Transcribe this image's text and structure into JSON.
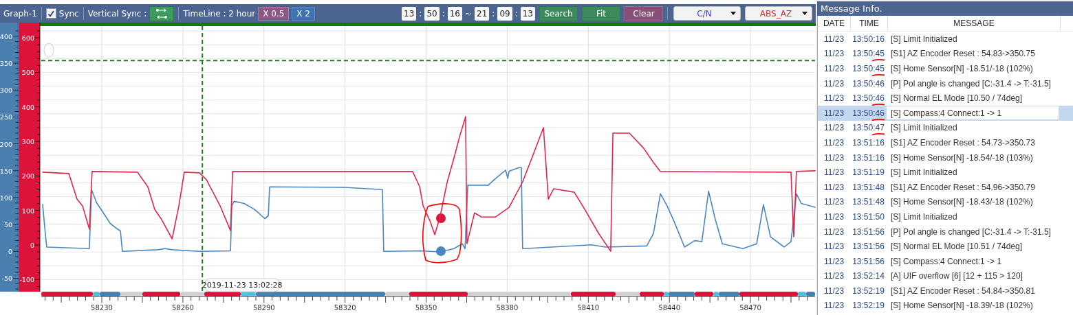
{
  "graph": {
    "title": "Graph-1",
    "sync": {
      "label": "Sync",
      "checked": true
    },
    "vertical_sync_label": "Vertical Sync :",
    "timeline_label": "TimeLine : 2 hour",
    "zoom_buttons": [
      {
        "label": "X 0.5",
        "kind": "zoom-out"
      },
      {
        "label": "X 2",
        "kind": "zoom-in"
      }
    ],
    "time_range": {
      "start": [
        "13",
        "50",
        "16"
      ],
      "end": [
        "21",
        "09",
        "13"
      ],
      "time_separator": ":",
      "range_separator": "~"
    },
    "buttons": [
      {
        "label": "Search",
        "kind": "search"
      },
      {
        "label": "Fit",
        "kind": "fit"
      },
      {
        "label": "Clear",
        "kind": "clear"
      }
    ],
    "dropdowns": [
      {
        "value": "C/N",
        "color": "#3344ee"
      },
      {
        "value": "ABS_AZ",
        "color": "#ee2233"
      }
    ],
    "cursor_tooltip": "2019-11-23 13:02:28",
    "chart_data": {
      "type": "line",
      "xlim": [
        58207.6,
        58493.9
      ],
      "ylim": [
        -75,
        419
      ],
      "y2lim": [
        -135,
        634
      ],
      "xticks": [
        58230,
        58260,
        58290,
        58320,
        58350,
        58380,
        58410,
        58440,
        58470
      ],
      "yticks": [
        -50,
        0,
        50,
        100,
        150,
        200,
        250,
        300,
        350,
        400
      ],
      "y2ticks": [
        -100,
        0,
        100,
        200,
        300,
        400,
        500,
        600
      ],
      "series": [
        {
          "color": "#4a86c0",
          "x": [
            58208.1,
            58209.1,
            58209.6,
            58225.4,
            58226.2,
            58228,
            58230.5,
            58233.1,
            58235.6,
            58236.9,
            58237.6,
            58250.9,
            58253.4,
            58256,
            58266.1,
            58277.6,
            58278.1,
            58278.9,
            58282.7,
            58286.5,
            58290.3,
            58291.6,
            58292.1,
            58319.6,
            58333.8,
            58334.3,
            58348.1,
            58355.2,
            58360.3,
            58363.4,
            58364.4,
            58365.4,
            58373,
            58375.1,
            58379.4,
            58380.2,
            58380.7,
            58384.5,
            58385.2,
            58385.7,
            58411.2,
            58416.3,
            58431.6,
            58434.1,
            58436.7,
            58439.2,
            58441.7,
            58445.6,
            58449.4,
            58452,
            58454.5,
            58457,
            58459.6,
            58467.2,
            58472.3,
            58474.8,
            58477.4,
            58482.5,
            58485,
            58487,
            58488.8,
            58493.9
          ],
          "values": [
            87,
            33,
            8,
            5,
            115,
            91,
            72,
            52,
            42,
            38,
            0,
            3,
            5,
            3,
            0,
            1,
            84,
            93,
            89,
            78,
            61,
            66,
            120,
            119,
            115,
            0,
            1,
            -1,
            5,
            14,
            5,
            123,
            123,
            133,
            151,
            136,
            149,
            156,
            156,
            5,
            12,
            8,
            10,
            33,
            107,
            84,
            56,
            8,
            20,
            18,
            112,
            59,
            14,
            5,
            14,
            87,
            27,
            8,
            18,
            107,
            89,
            82
          ]
        },
        {
          "color": "#e0284a",
          "axis": "y2",
          "x": [
            58208.1,
            58217.8,
            58220.8,
            58222.9,
            58225.4,
            58226.4,
            58243.2,
            58247,
            58249.6,
            58252.1,
            58256,
            58258.5,
            58260.5,
            58266.1,
            58268.7,
            58273.8,
            58277.6,
            58278.4,
            58345,
            58347.6,
            58348.9,
            58351.4,
            58353.2,
            58355.2,
            58357.8,
            58360.3,
            58362.3,
            58364.6,
            58365.1,
            58367.9,
            58370.5,
            58375.6,
            58380.7,
            58385.7,
            58389.6,
            58393.4,
            58395.2,
            58397.2,
            58404.8,
            58408.7,
            58413.8,
            58418.3,
            58419.1,
            58425.2,
            58430.3,
            58434.1,
            58436.7,
            58485,
            58486,
            58487,
            58493.9
          ],
          "values": [
            211,
            207,
            133,
            113,
            46,
            213,
            211,
            169,
            103,
            74,
            18,
            113,
            211,
            209,
            189,
            113,
            42,
            213,
            213,
            169,
            113,
            70,
            30,
            84,
            183,
            252,
            312,
            372,
            4,
            93,
            81,
            81,
            109,
            183,
            262,
            340,
            133,
            163,
            153,
            103,
            34,
            -18,
            324,
            324,
            282,
            239,
            213,
            211,
            24,
            213,
            215
          ]
        }
      ],
      "grid": true,
      "ref_lines": [
        {
          "axis": "y",
          "value": 355
        },
        {
          "axis": "x",
          "value": 58267.2
        }
      ]
    }
  },
  "messages": {
    "title": "Message Info.",
    "columns": [
      "DATE",
      "TIME",
      "MESSAGE"
    ],
    "rows": [
      {
        "date": "11/23",
        "time": "13:50:16",
        "message": "[S] Limit Initialized",
        "selected": false,
        "underlined": false
      },
      {
        "date": "11/23",
        "time": "13:50:45",
        "message": "[S1] AZ Encoder Reset : 54.83->350.75",
        "selected": false,
        "underlined": true
      },
      {
        "date": "11/23",
        "time": "13:50:45",
        "message": "[S] Home Sensor[N] -18.51/-18 (102%)",
        "selected": false,
        "underlined": true
      },
      {
        "date": "11/23",
        "time": "13:50:46",
        "message": "[P] Pol angle is changed [C:-31.4 -> T:-31.5]",
        "selected": false,
        "underlined": false
      },
      {
        "date": "11/23",
        "time": "13:50:46",
        "message": "[S] Normal EL Mode [10.50 / 74deg]",
        "selected": false,
        "underlined": true
      },
      {
        "date": "11/23",
        "time": "13:50:46",
        "message": "[S] Compass:4 Connect:1 -> 1",
        "selected": true,
        "underlined": true
      },
      {
        "date": "11/23",
        "time": "13:50:47",
        "message": "[S] Limit Initialized",
        "selected": false,
        "underlined": true
      },
      {
        "date": "11/23",
        "time": "13:51:16",
        "message": "[S1] AZ Encoder Reset : 54.73->350.73",
        "selected": false,
        "underlined": false
      },
      {
        "date": "11/23",
        "time": "13:51:16",
        "message": "[S] Home Sensor[N] -18.54/-18 (103%)",
        "selected": false,
        "underlined": false
      },
      {
        "date": "11/23",
        "time": "13:51:19",
        "message": "[S] Limit Initialized",
        "selected": false,
        "underlined": false
      },
      {
        "date": "11/23",
        "time": "13:51:48",
        "message": "[S1] AZ Encoder Reset : 54.96->350.79",
        "selected": false,
        "underlined": false
      },
      {
        "date": "11/23",
        "time": "13:51:48",
        "message": "[S] Home Sensor[N] -18.43/-18 (102%)",
        "selected": false,
        "underlined": false
      },
      {
        "date": "11/23",
        "time": "13:51:50",
        "message": "[S] Limit Initialized",
        "selected": false,
        "underlined": false
      },
      {
        "date": "11/23",
        "time": "13:51:56",
        "message": "[P] Pol angle is changed [C:-31.4 -> T:-31.5]",
        "selected": false,
        "underlined": false
      },
      {
        "date": "11/23",
        "time": "13:51:56",
        "message": "[S] Normal EL Mode [10.51 / 74deg]",
        "selected": false,
        "underlined": false
      },
      {
        "date": "11/23",
        "time": "13:51:56",
        "message": "[S] Compass:4 Connect:1 -> 1",
        "selected": false,
        "underlined": false
      },
      {
        "date": "11/23",
        "time": "13:52:14",
        "message": "[A] UIF overflow [6] [12 + 115 > 120]",
        "selected": false,
        "underlined": false
      },
      {
        "date": "11/23",
        "time": "13:52:19",
        "message": "[S1] AZ Encoder Reset : 54.84->350.81",
        "selected": false,
        "underlined": false
      },
      {
        "date": "11/23",
        "time": "13:52:19",
        "message": "[S] Home Sensor[N] -18.39/-18 (102%)",
        "selected": false,
        "underlined": false
      }
    ]
  }
}
